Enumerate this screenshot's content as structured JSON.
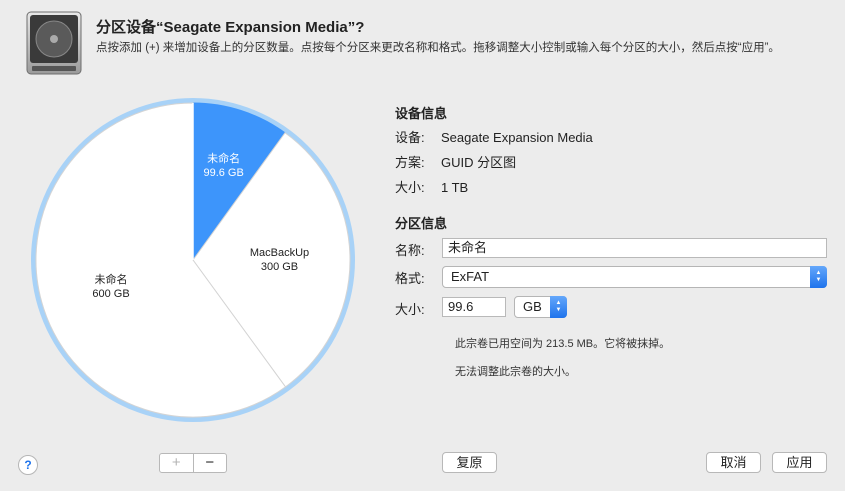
{
  "header": {
    "title": "分区设备“Seagate Expansion Media”?",
    "description": "点按添加 (+) 来增加设备上的分区数量。点按每个分区来更改名称和格式。拖移调整大小控制或输入每个分区的大小，然后点按“应用”。"
  },
  "pie": {
    "slices": [
      {
        "name": "未命名",
        "size": "99.6 GB",
        "value": 99.6,
        "selected": true,
        "color": "#3d95fb"
      },
      {
        "name": "MacBackUp",
        "size": "300 GB",
        "value": 300,
        "selected": false,
        "color": "#ffffff"
      },
      {
        "name": "未命名",
        "size": "600 GB",
        "value": 600,
        "selected": false,
        "color": "#ffffff"
      }
    ],
    "ring_color": "#a8d2f7"
  },
  "device_info": {
    "title": "设备信息",
    "device_label": "设备:",
    "device_value": "Seagate Expansion Media",
    "scheme_label": "方案:",
    "scheme_value": "GUID 分区图",
    "size_label": "大小:",
    "size_value": "1 TB"
  },
  "partition_info": {
    "title": "分区信息",
    "name_label": "名称:",
    "name_value": "未命名",
    "format_label": "格式:",
    "format_value": "ExFAT",
    "size_label": "大小:",
    "size_value": "99.6",
    "unit_value": "GB",
    "note1": "此宗卷已用空间为 213.5 MB。它将被抹掉。",
    "note2": "无法调整此宗卷的大小。"
  },
  "footer": {
    "help": "?",
    "add": "+",
    "remove": "−",
    "revert": "复原",
    "cancel": "取消",
    "apply": "应用"
  },
  "colors": {
    "accent": "#1e73ec"
  }
}
